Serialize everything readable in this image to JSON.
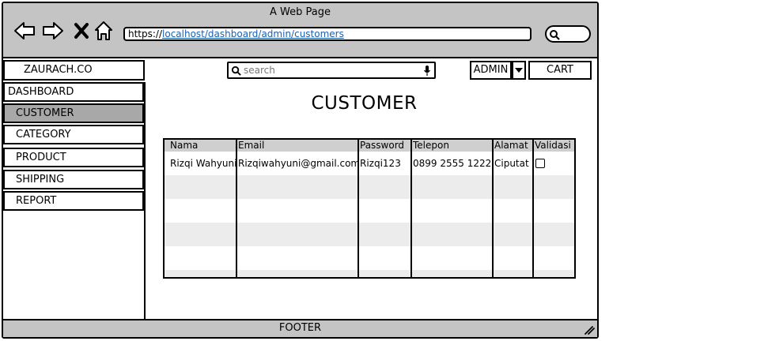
{
  "window": {
    "title": "A Web Page",
    "url_prefix": "https://",
    "url_path": "localhost/dashboard/admin/customers"
  },
  "header": {
    "brand": "ZAURACH.CO",
    "search_placeholder": "search",
    "admin_label": "ADMIN",
    "cart_label": "CART"
  },
  "sidebar": {
    "items": [
      {
        "label": "DASHBOARD"
      },
      {
        "label": "CUSTOMER",
        "active": true
      },
      {
        "label": "CATEGORY"
      },
      {
        "label": "PRODUCT"
      },
      {
        "label": "SHIPPING"
      },
      {
        "label": "REPORT"
      }
    ]
  },
  "main": {
    "title": "CUSTOMER",
    "table": {
      "columns": [
        "Nama",
        "Email",
        "Password",
        "Telepon",
        "Alamat",
        "Validasi"
      ],
      "rows": [
        [
          "Rizqi Wahyuni",
          "Rizqiwahyuni@gmail.com",
          "Rizqi123",
          "0899 2555 1222",
          "Ciputat",
          ""
        ]
      ],
      "validasi_checked": [
        false
      ]
    }
  },
  "footer": {
    "label": "FOOTER"
  },
  "colors": {
    "chrome": "#c4c4c4",
    "active_item": "#a8a8a8",
    "header_row": "#cfcfcf",
    "stripe": "#ececec",
    "link": "#1a5fb4"
  },
  "icons": [
    "back-arrow-icon",
    "forward-arrow-icon",
    "close-icon",
    "home-icon",
    "search-icon",
    "microphone-icon",
    "chevron-down-icon",
    "resize-grip-icon"
  ]
}
